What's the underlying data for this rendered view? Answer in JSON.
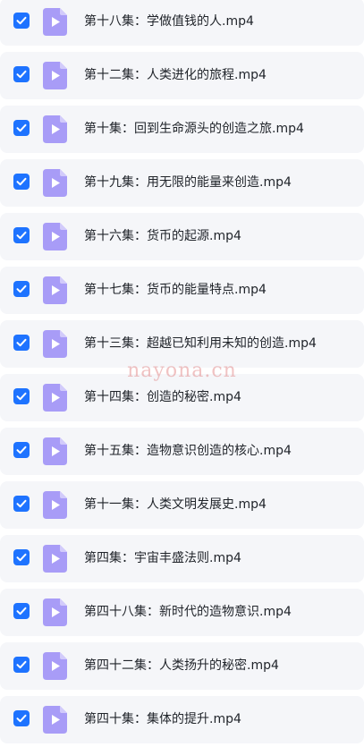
{
  "colors": {
    "checkbox": "#1e73ff",
    "file_icon": "#a89cf7",
    "row_background": "#f5f6f9",
    "text": "#1f2329",
    "watermark": "#e07a7a"
  },
  "icons": {
    "checkbox": "checkmark-icon",
    "file": "video-file-icon"
  },
  "files": [
    {
      "name": "第十八集：学做值钱的人.mp4",
      "checked": true
    },
    {
      "name": "第十二集：人类进化的旅程.mp4",
      "checked": true
    },
    {
      "name": "第十集：回到生命源头的创造之旅.mp4",
      "checked": true
    },
    {
      "name": "第十九集：用无限的能量来创造.mp4",
      "checked": true
    },
    {
      "name": "第十六集：货币的起源.mp4",
      "checked": true
    },
    {
      "name": "第十七集：货币的能量特点.mp4",
      "checked": true
    },
    {
      "name": "第十三集：超越已知利用未知的创造.mp4",
      "checked": true
    },
    {
      "name": "第十四集：创造的秘密.mp4",
      "checked": true
    },
    {
      "name": "第十五集：造物意识创造的核心.mp4",
      "checked": true
    },
    {
      "name": "第十一集：人类文明发展史.mp4",
      "checked": true
    },
    {
      "name": "第四集：宇宙丰盛法则.mp4",
      "checked": true
    },
    {
      "name": "第四十八集：新时代的造物意识.mp4",
      "checked": true
    },
    {
      "name": "第四十二集：人类扬升的秘密.mp4",
      "checked": true
    },
    {
      "name": "第四十集：集体的提升.mp4",
      "checked": true
    }
  ],
  "watermark": "nayona.cn"
}
